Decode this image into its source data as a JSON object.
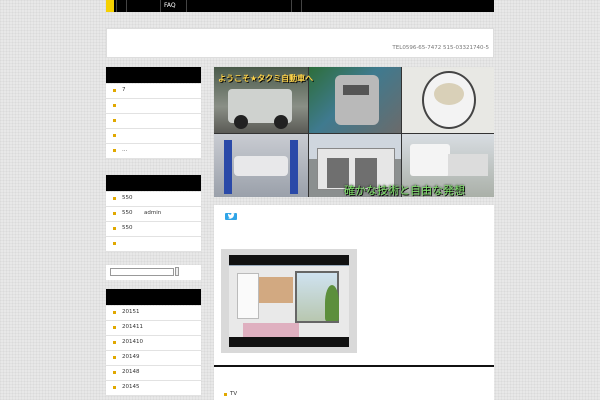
{
  "nav": {
    "faq_label": "FAQ"
  },
  "header": {
    "tel": "TEL0596-65-7472 515-03321740-5"
  },
  "sidebar": {
    "menu1": [
      "7",
      "",
      "",
      "",
      "..."
    ],
    "menu2": [
      {
        "a": "550",
        "b": ""
      },
      {
        "a": "550",
        "b": "admin"
      },
      {
        "a": "550",
        "b": ""
      },
      {
        "a": "",
        "b": ""
      }
    ],
    "archives": [
      "20151",
      "201411",
      "201410",
      "20149",
      "20148",
      "20145"
    ]
  },
  "banner": {
    "tagline": "確かな技術と自由な発想",
    "welcome": "ようこそ★タクミ自動車へ"
  },
  "content": {
    "tv_label": "TV"
  },
  "colors": {
    "accent": "#f5d000",
    "bullet": "#e0a800",
    "tagline": "#7fe36a",
    "twitter": "#2fa4e7"
  },
  "icons": [
    "twitter-icon",
    "search-icon"
  ]
}
